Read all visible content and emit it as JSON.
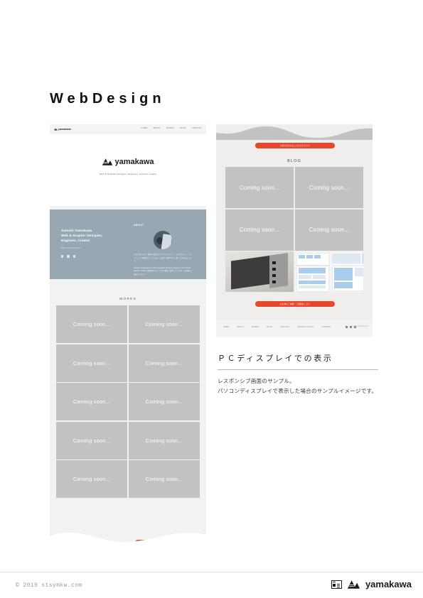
{
  "page": {
    "title": "WebDesign"
  },
  "brand": {
    "name": "yamakawa",
    "tagline": "Web & Graphic Designer, Engineer, Content creator"
  },
  "mobile_mockup": {
    "nav": [
      "HOME",
      "ABOUT",
      "WORKS",
      "BLOG",
      "CONTACT"
    ],
    "hero": {
      "logo": "yamakawa",
      "tagline": "Web & Graphic Designer, Engineer, Content creator"
    },
    "about": {
      "name_lines": "Satoshi Yamakawa\nWeb & Graphic Designer,\nEngineer, Creator",
      "url": "https://stsymkw.com",
      "heading": "ABOUT",
      "paragraph_1": "山川と申します。神奈川を拠点にウェブとグラフィックのデザイン、フロントエンド開発を行っています。企画から制作まで一貫して対応いたします。",
      "paragraph_2": "Satoshi Yamakawa is a Web & Graphic Designer, Engineer and Creator based in Japan. 紙媒体からウェブまで幅広く制作しています。お気軽にご相談ください。",
      "more_label": "more"
    },
    "works": {
      "heading": "WORKS",
      "tile_label": "Coming soon...",
      "tile_count": 10
    }
  },
  "pc_mockup": {
    "cta_top": "お問い合わせはこちらからどうぞ",
    "cta_bottom": "お仕事のご依頼・ご相談はこちら",
    "blog": {
      "heading": "BLOG",
      "tile_label": "Coming soon...",
      "tile_count": 4
    },
    "footer": {
      "nav": [
        "HOME",
        "ABOUT",
        "WORKS",
        "BLOG",
        "CONTACT",
        "PRIVACY POLICY",
        "SITEMAP"
      ],
      "copyright": "© 2019 stsymkw.com"
    }
  },
  "caption": {
    "title": "ＰＣディスプレイでの表示",
    "body": "レスポンシブ画面のサンプル。\nパソコンディスプレイで表示した場合のサンプルイメージです。"
  },
  "footer": {
    "copyright": "© 2019 stsymkw.com",
    "brand": "yamakawa"
  },
  "colors": {
    "accent": "#e8472c",
    "panel_blue": "#97a8b3",
    "tile_gray": "#c2c2c2",
    "page_bg": "#f2f2f0"
  }
}
